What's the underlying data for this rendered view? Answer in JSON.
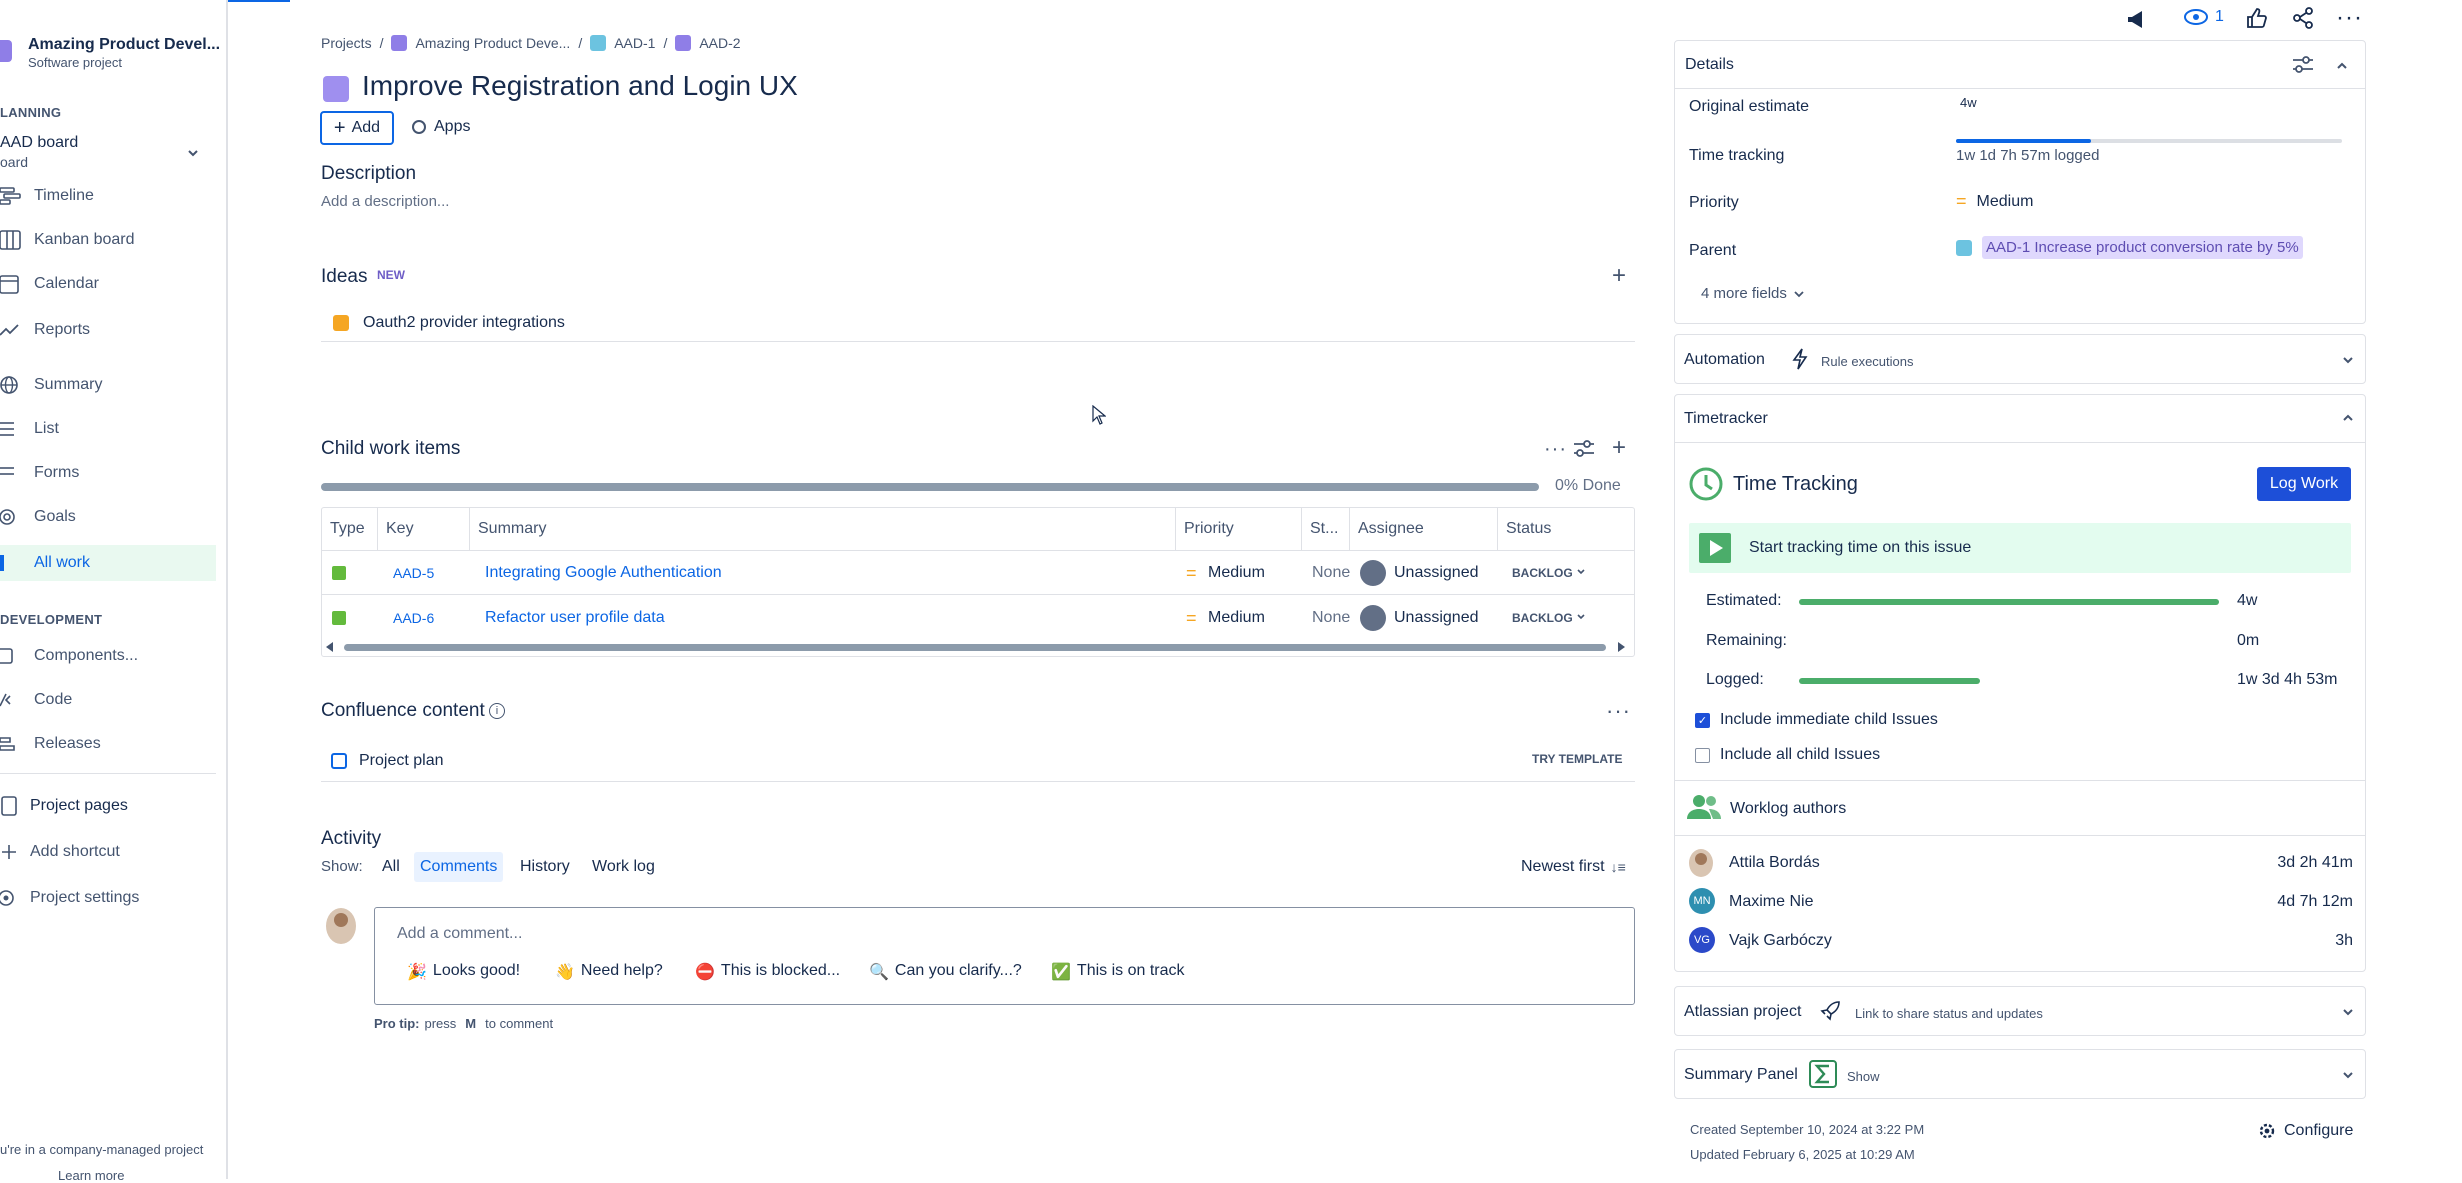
{
  "sidebar": {
    "project_name": "Amazing Product Devel...",
    "project_type": "Software project",
    "planning_label": "LANNING",
    "board_name": "AAD board",
    "board_sub": "oard",
    "items": [
      {
        "label": "Timeline"
      },
      {
        "label": "Kanban board"
      },
      {
        "label": "Calendar"
      },
      {
        "label": "Reports"
      },
      {
        "label": "Summary"
      },
      {
        "label": "List"
      },
      {
        "label": "Forms"
      },
      {
        "label": "Goals"
      },
      {
        "label": "All work"
      }
    ],
    "development_label": "DEVELOPMENT",
    "dev_items": [
      {
        "label": "Components..."
      },
      {
        "label": "Code"
      },
      {
        "label": "Releases"
      }
    ],
    "bottom_items": [
      {
        "label": "Project pages"
      },
      {
        "label": "Add shortcut"
      },
      {
        "label": "Project settings"
      }
    ],
    "footer": "u're in a company-managed project",
    "footer_link": "Learn more"
  },
  "breadcrumb": {
    "projects": "Projects",
    "project": "Amazing Product Deve...",
    "parent": "AAD-1",
    "issue": "AAD-2"
  },
  "issue": {
    "title": "Improve Registration and Login UX",
    "add_label": "Add",
    "apps_label": "Apps",
    "description_label": "Description",
    "description_placeholder": "Add a description..."
  },
  "ideas": {
    "title": "Ideas",
    "badge": "NEW",
    "item": "Oauth2 provider integrations"
  },
  "child_items": {
    "title": "Child work items",
    "done_text": "0% Done",
    "progress_fraction": 0.0,
    "columns": [
      "Type",
      "Key",
      "Summary",
      "Priority",
      "St...",
      "Assignee",
      "Status"
    ],
    "rows": [
      {
        "key": "AAD-5",
        "summary": "Integrating Google Authentication",
        "priority": "Medium",
        "story_points": "None",
        "assignee": "Unassigned",
        "status": "BACKLOG"
      },
      {
        "key": "AAD-6",
        "summary": "Refactor user profile data",
        "priority": "Medium",
        "story_points": "None",
        "assignee": "Unassigned",
        "status": "BACKLOG"
      }
    ]
  },
  "confluence": {
    "title": "Confluence content",
    "item": "Project plan",
    "action": "TRY TEMPLATE"
  },
  "activity": {
    "title": "Activity",
    "show_label": "Show:",
    "filters": [
      "All",
      "Comments",
      "History",
      "Work log"
    ],
    "active_filter": "Comments",
    "sort": "Newest first",
    "comment_placeholder": "Add a comment...",
    "quick_replies": [
      "Looks good!",
      "Need help?",
      "This is blocked...",
      "Can you clarify...?",
      "This is on track"
    ],
    "pro_tip_prefix": "Pro tip:",
    "pro_tip_press": "press",
    "pro_tip_key": "M",
    "pro_tip_suffix": "to comment"
  },
  "topbar": {
    "watch_count": "1"
  },
  "details": {
    "title": "Details",
    "original_estimate_label": "Original estimate",
    "original_estimate_value": "4w",
    "time_tracking_label": "Time tracking",
    "time_tracking_value": "1w 1d 7h 57m logged",
    "time_tracking_fraction": 0.35,
    "priority_label": "Priority",
    "priority_value": "Medium",
    "parent_label": "Parent",
    "parent_value": "AAD-1 Increase product conversion rate by 5%",
    "more_fields": "4 more fields"
  },
  "automation": {
    "title": "Automation",
    "sub": "Rule executions"
  },
  "timetracker": {
    "title": "Timetracker",
    "heading": "Time Tracking",
    "log_work": "Log Work",
    "start_text": "Start tracking time on this issue",
    "estimated_label": "Estimated:",
    "estimated_value": "4w",
    "estimated_fraction": 1.0,
    "remaining_label": "Remaining:",
    "remaining_value": "0m",
    "logged_label": "Logged:",
    "logged_value": "1w 3d 4h 53m",
    "logged_fraction": 0.43,
    "include_immediate": "Include immediate child Issues",
    "include_all": "Include all child Issues",
    "worklog_title": "Worklog authors",
    "authors": [
      {
        "name": "Attila Bordás",
        "time": "3d 2h 41m",
        "initials": ""
      },
      {
        "name": "Maxime Nie",
        "time": "4d 7h 12m",
        "initials": "MN"
      },
      {
        "name": "Vajk Garbóczy",
        "time": "3h",
        "initials": "VG"
      }
    ]
  },
  "atlassian_project": {
    "title": "Atlassian project",
    "sub": "Link to share status and updates"
  },
  "summary_panel": {
    "title": "Summary Panel",
    "sub": "Show"
  },
  "meta": {
    "created": "Created September 10, 2024 at 3:22 PM",
    "updated": "Updated February 6, 2025 at 10:29 AM",
    "configure": "Configure"
  },
  "colors": {
    "brand": "#0c66e4",
    "green": "#4bad6a",
    "purple": "#9f8fef",
    "orange": "#f5a623"
  }
}
